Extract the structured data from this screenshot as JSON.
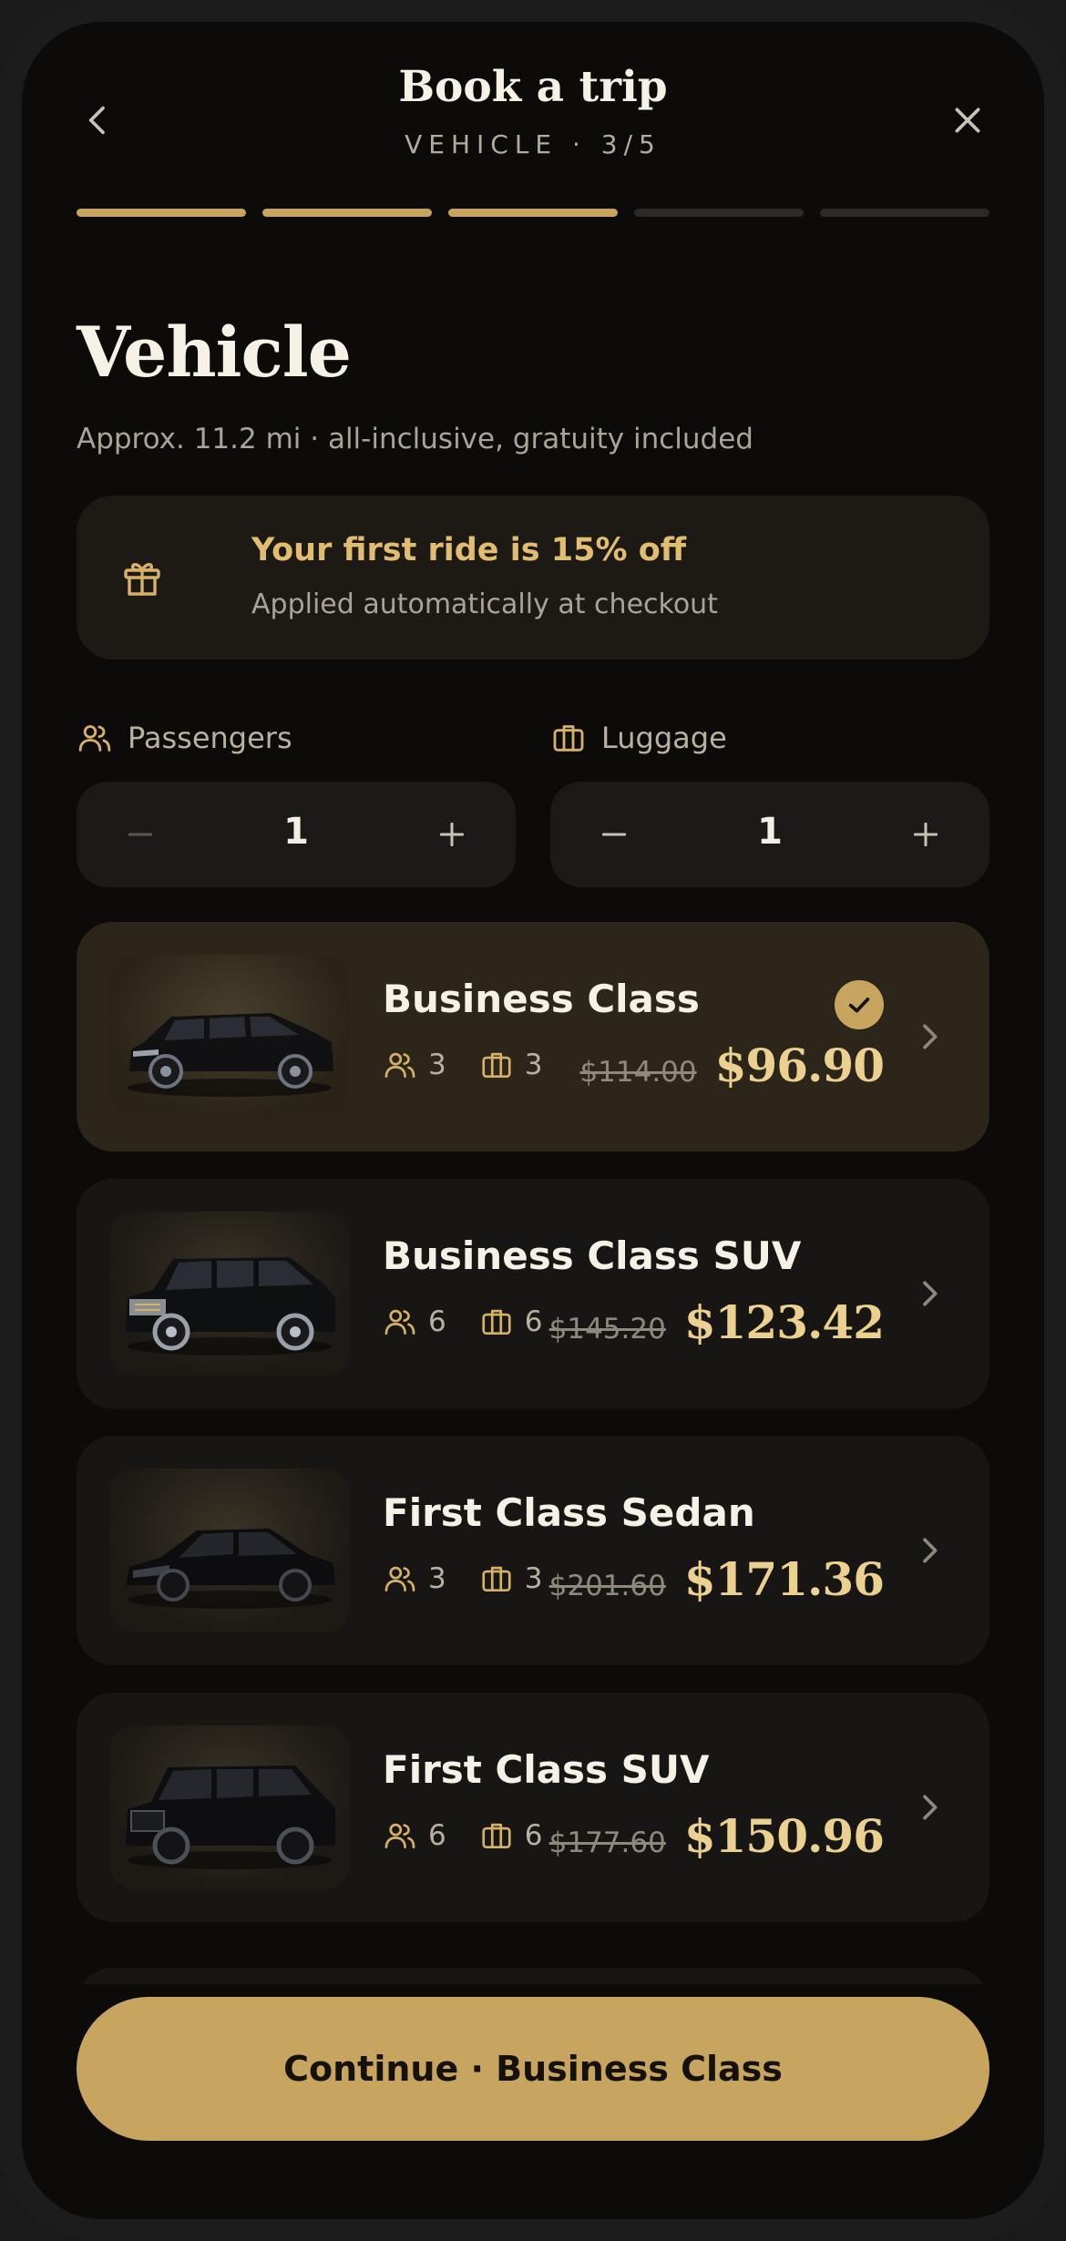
{
  "header": {
    "title": "Book a trip",
    "step_label": "VEHICLE · 3/5",
    "progress": {
      "total_steps": 5,
      "completed_steps": 3
    }
  },
  "page": {
    "heading": "Vehicle",
    "subtitle": "Approx. 11.2 mi · all-inclusive, gratuity included"
  },
  "promo": {
    "title": "Your first ride is 15% off",
    "subtitle": "Applied automatically at checkout",
    "icon": "gift-icon"
  },
  "passengers": {
    "label": "Passengers",
    "value": "1",
    "icon": "users-icon"
  },
  "luggage": {
    "label": "Luggage",
    "value": "1",
    "icon": "briefcase-icon"
  },
  "vehicles": [
    {
      "name": "Business Class",
      "passengers": "3",
      "luggage": "3",
      "original_price": "$114.00",
      "price": "$96.90",
      "selected": true
    },
    {
      "name": "Business Class SUV",
      "passengers": "6",
      "luggage": "6",
      "original_price": "$145.20",
      "price": "$123.42",
      "selected": false
    },
    {
      "name": "First Class Sedan",
      "passengers": "3",
      "luggage": "3",
      "original_price": "$201.60",
      "price": "$171.36",
      "selected": false
    },
    {
      "name": "First Class SUV",
      "passengers": "6",
      "luggage": "6",
      "original_price": "$177.60",
      "price": "$150.96",
      "selected": false
    }
  ],
  "cta": {
    "label": "Continue · Business Class"
  },
  "colors": {
    "accent": "#c8a55f",
    "price": "#ecd08f",
    "background": "#0c0b0a",
    "card": "#171614",
    "selected_card": "#2b251a"
  }
}
